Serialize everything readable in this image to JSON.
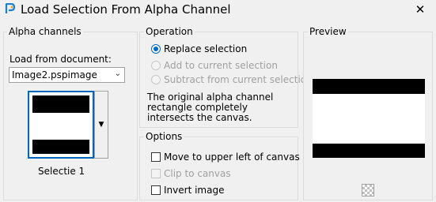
{
  "window": {
    "title": "Load Selection From Alpha Channel",
    "close_label": "✕"
  },
  "alpha_channels": {
    "group_label": "Alpha channels",
    "load_from_label": "Load from document:",
    "document_value": "Image2.pspimage",
    "thumbnail_caption": "Selectie 1"
  },
  "operation": {
    "group_label": "Operation",
    "options": [
      {
        "label": "Replace selection",
        "selected": true,
        "enabled": true
      },
      {
        "label": "Add to current selection",
        "selected": false,
        "enabled": false
      },
      {
        "label": "Subtract from current selection",
        "selected": false,
        "enabled": false
      }
    ],
    "description": "The original alpha channel rectangle completely intersects the canvas."
  },
  "options": {
    "group_label": "Options",
    "items": [
      {
        "label": "Move to upper left of canvas",
        "checked": false,
        "enabled": true
      },
      {
        "label": "Clip to canvas",
        "checked": false,
        "enabled": false
      },
      {
        "label": "Invert image",
        "checked": false,
        "enabled": true
      }
    ]
  },
  "preview": {
    "group_label": "Preview"
  },
  "colors": {
    "accent": "#0067c0",
    "disabled_text": "#a0a0a0",
    "background": "#f0f0f0"
  }
}
